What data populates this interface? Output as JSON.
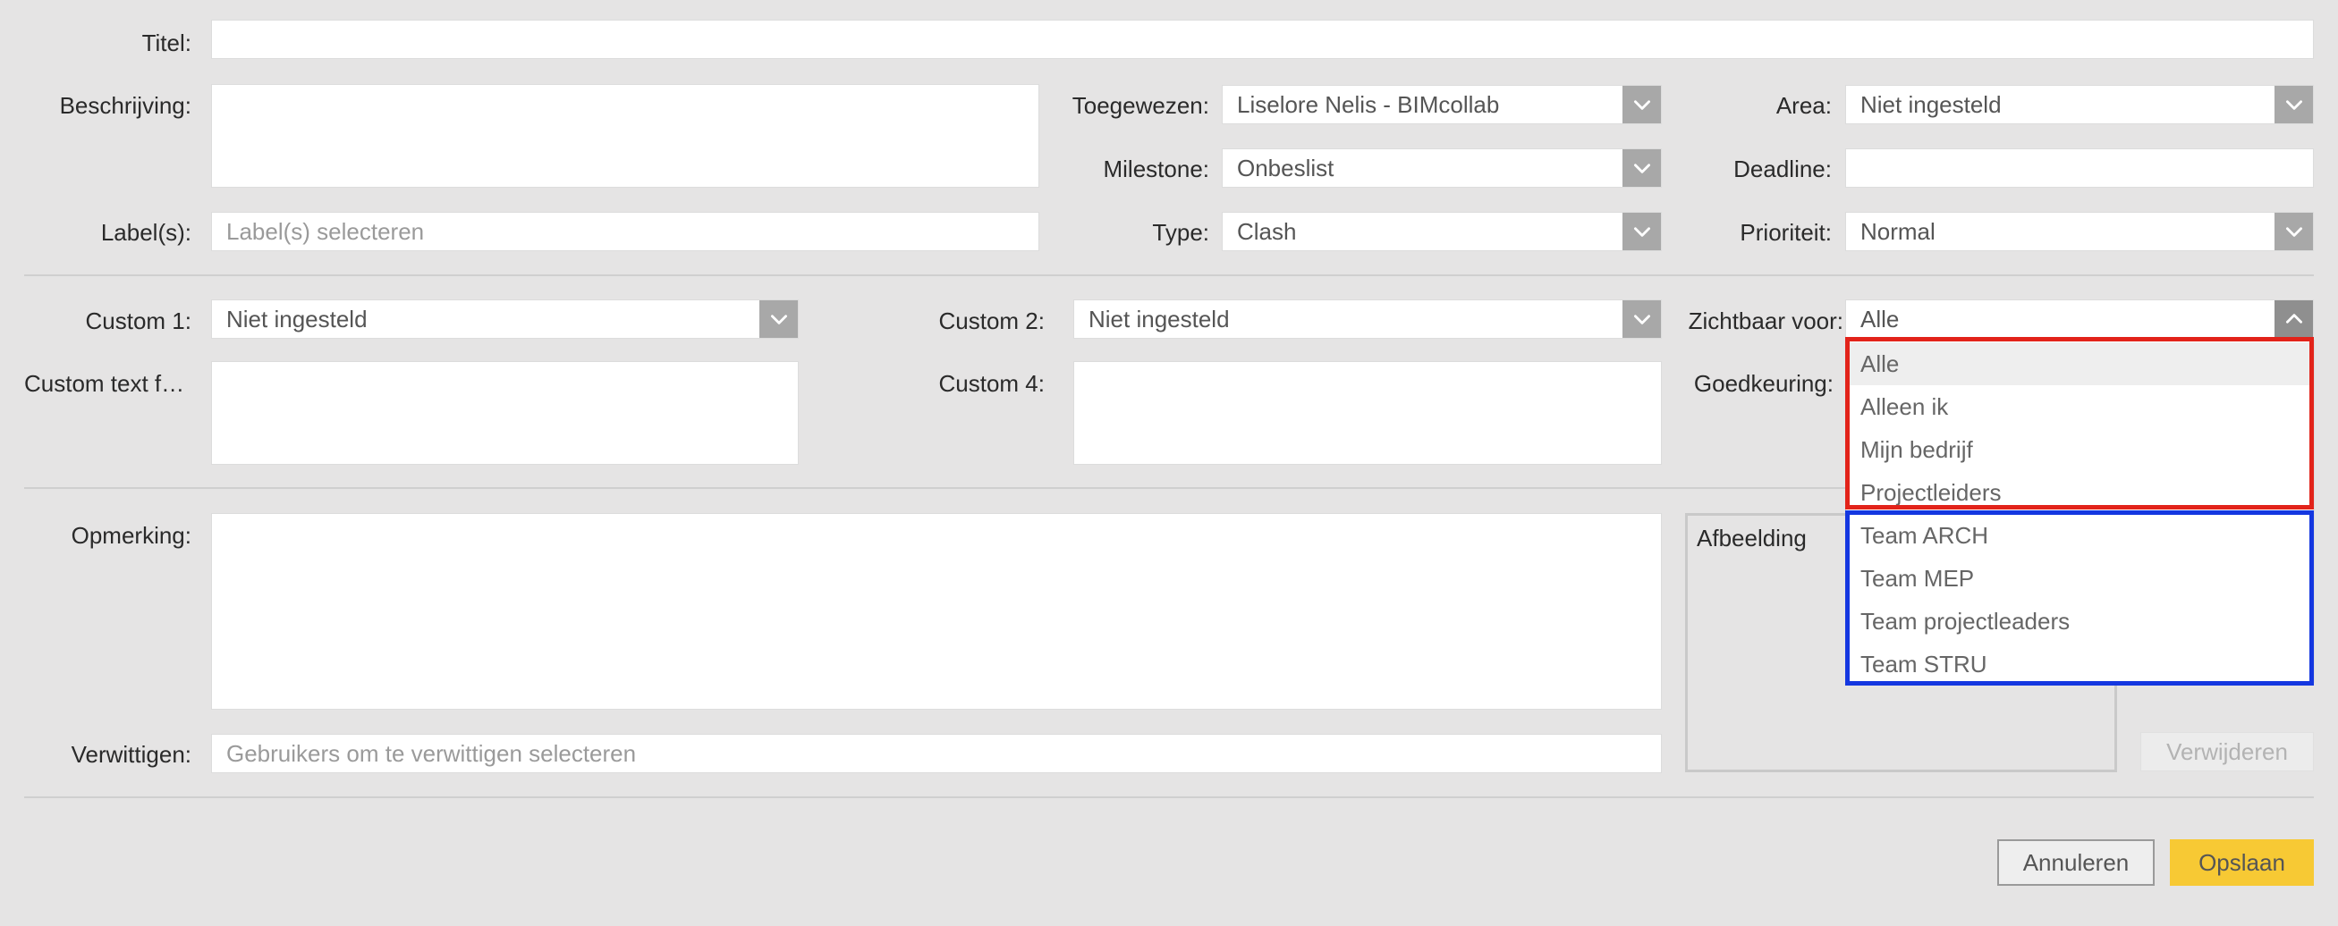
{
  "labels": {
    "titel": "Titel:",
    "beschrijving": "Beschrijving:",
    "toegewezen": "Toegewezen:",
    "area": "Area:",
    "milestone": "Milestone:",
    "deadline": "Deadline:",
    "labels": "Label(s):",
    "type": "Type:",
    "prioriteit": "Prioriteit:",
    "custom1": "Custom 1:",
    "custom2": "Custom 2:",
    "zichtbaar": "Zichtbaar voor:",
    "customtext": "Custom text f…",
    "custom4": "Custom 4:",
    "goedkeuring": "Goedkeuring:",
    "opmerking": "Opmerking:",
    "verwittigen": "Verwittigen:"
  },
  "values": {
    "titel": "",
    "toegewezen": "Liselore Nelis - BIMcollab",
    "area": "Niet ingesteld",
    "milestone": "Onbeslist",
    "deadline": "",
    "type": "Clash",
    "prioriteit": "Normal",
    "custom1": "Niet ingesteld",
    "custom2": "Niet ingesteld",
    "zichtbaar": "Alle"
  },
  "placeholders": {
    "labels": "Label(s) selecteren",
    "verwittigen": "Gebruikers om te verwittigen selecteren"
  },
  "dropdown": {
    "options": [
      "Alle",
      "Alleen ik",
      "Mijn bedrijf",
      "Projectleiders",
      "Team ARCH",
      "Team MEP",
      "Team projectleaders",
      "Team STRU"
    ],
    "selected": "Alle"
  },
  "image": {
    "label": "Afbeelding",
    "remove_button": "Verwijderen"
  },
  "buttons": {
    "cancel": "Annuleren",
    "save": "Opslaan"
  },
  "colors": {
    "background": "#e5e4e4",
    "caret": "#a8a8a8",
    "save_button": "#f7c934",
    "highlight_red": "#e2231a",
    "highlight_blue": "#1437e0"
  },
  "icons": {
    "caret_down": "chevron-down-icon",
    "caret_up": "chevron-up-icon"
  }
}
